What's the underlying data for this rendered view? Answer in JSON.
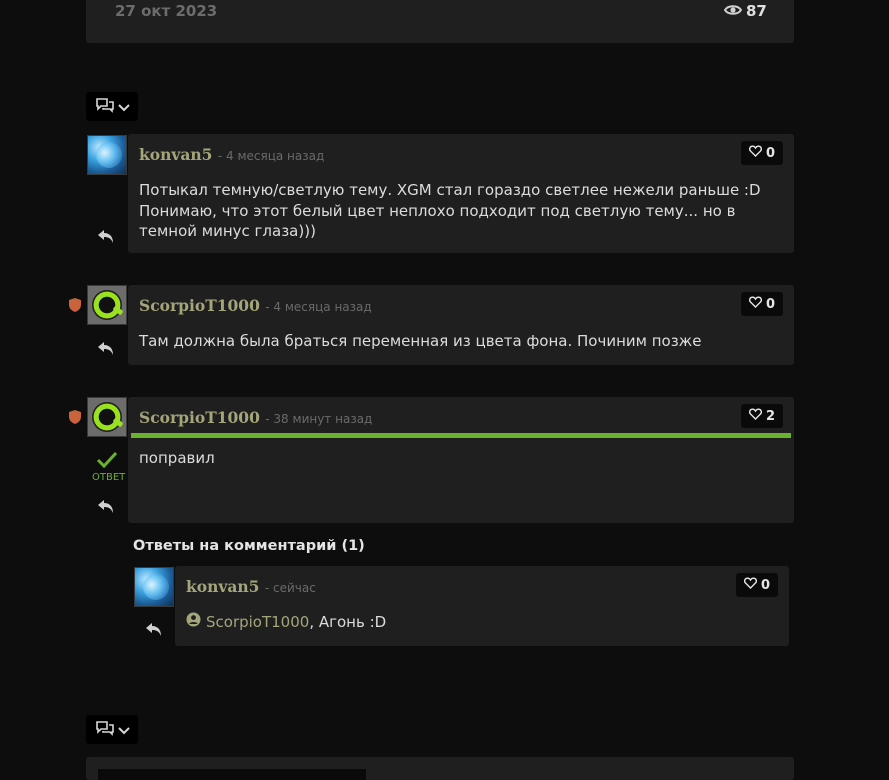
{
  "top_post": {
    "date": "27 окт 2023",
    "views": "87",
    "views_icon": "eye-icon"
  },
  "toolbar_icons": {
    "comments_icon": "comments-icon",
    "chevron": "chevron-down-icon"
  },
  "comments": [
    {
      "author": "konvan5",
      "time": "- 4 месяца назад",
      "likes": "0",
      "lines": [
        "Потыкал темную/светлую тему. XGM стал гораздо светлее нежели раньше :D",
        "Понимаю, что этот белый цвет неплохо подходит под светлую тему... но в",
        "темной минус глаза)))"
      ]
    },
    {
      "author": "ScorpioT1000",
      "time": "- 4 месяца назад",
      "likes": "0",
      "lines": [
        "Там должна была браться переменная из цвета фона. Починим позже"
      ]
    },
    {
      "author": "ScorpioT1000",
      "time": "- 38 минут назад",
      "likes": "2",
      "lines": [
        "поправил"
      ],
      "answer_label": "ОТВЕТ"
    }
  ],
  "replies_header": "Ответы на комментарий (1)",
  "reply": {
    "author": "konvan5",
    "time": "- сейчас",
    "likes": "0",
    "mention": "ScorpioT1000",
    "text": ", Агонь :D"
  },
  "colors": {
    "background": "#0d0d0d",
    "card": "#1f1f1f",
    "accent_green": "#6ab42d",
    "name": "#a5a57c",
    "shield": "#c9633c"
  }
}
